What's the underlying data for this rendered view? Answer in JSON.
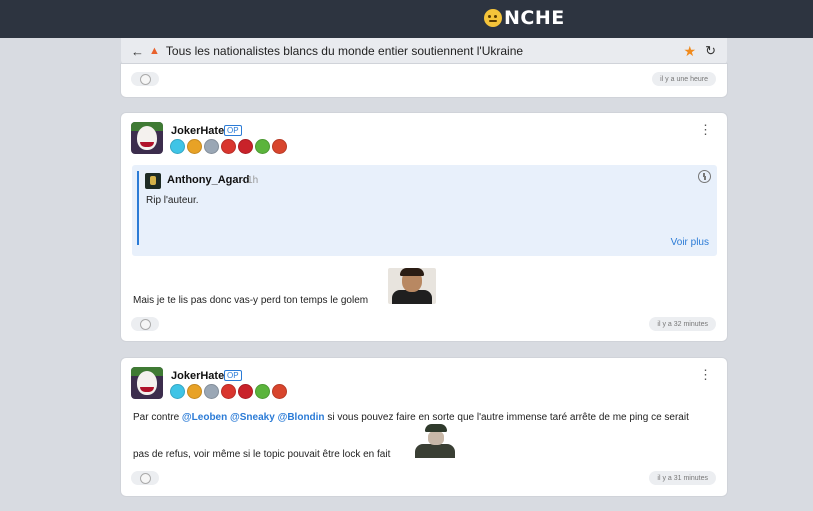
{
  "topbar": {
    "logo_text": "NCHE"
  },
  "topic": {
    "title": "Tous les nationalistes blancs du monde entier soutiennent l'Ukraine"
  },
  "post0": {
    "time": "il y a une heure"
  },
  "post1": {
    "username": "JokerHate",
    "op_label": "OP",
    "quote": {
      "username": "Anthony_Agard",
      "time": "· 1h",
      "text": "Rip l'auteur.",
      "more_label": "Voir plus"
    },
    "text": "Mais je te lis pas donc vas-y perd ton temps le golem",
    "time": "il y a 32 minutes"
  },
  "post2": {
    "username": "JokerHate",
    "op_label": "OP",
    "text_before": "Par contre ",
    "mention1": "@Leoben",
    "mention2": "@Sneaky",
    "mention3": "@Blondin",
    "text_after": " si vous pouvez faire en sorte que l'autre immense taré arrête de me ping ce serait",
    "text_line2": "pas de refus, voir même si le topic pouvait être lock en fait",
    "time": "il y a 31 minutes"
  },
  "badge_colors": [
    "#3fc4e6",
    "#e8a226",
    "#9aa7b5",
    "#d9352e",
    "#c9222a",
    "#5bb43c",
    "#d8452d"
  ],
  "icons": {
    "back": "arrow-left-icon",
    "fire": "fire-icon",
    "star": "star-icon",
    "refresh": "refresh-icon",
    "menu": "vertical-dots-icon",
    "history": "history-icon",
    "reaction": "smiley-icon"
  }
}
